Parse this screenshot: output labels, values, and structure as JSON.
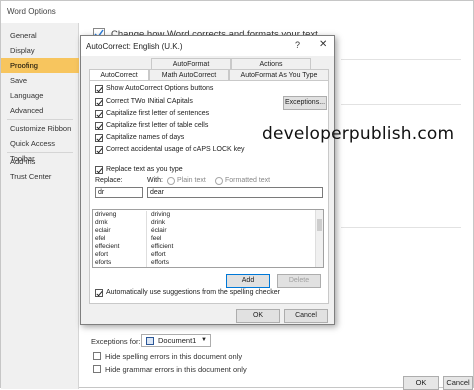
{
  "window": {
    "title": "Word Options"
  },
  "sidebar": {
    "items": [
      {
        "label": "General"
      },
      {
        "label": "Display"
      },
      {
        "label": "Proofing"
      },
      {
        "label": "Save"
      },
      {
        "label": "Language"
      },
      {
        "label": "Advanced"
      },
      {
        "label": "Customize Ribbon"
      },
      {
        "label": "Quick Access Toolbar"
      },
      {
        "label": "Add-ins"
      },
      {
        "label": "Trust Center"
      }
    ],
    "active": "Proofing"
  },
  "background": {
    "heading": "Change how Word corrects and formats your text.",
    "exceptions_label": "Exceptions for:",
    "exceptions_doc": "Document1",
    "hide_spelling": "Hide spelling errors in this document only",
    "hide_grammar": "Hide grammar errors in this document only"
  },
  "dialog": {
    "title": "AutoCorrect: English (U.K.)",
    "help_glyph": "?",
    "close_glyph": "✕",
    "tabs_top": [
      "AutoFormat",
      "Actions"
    ],
    "tabs_bottom": [
      "AutoCorrect",
      "Math AutoCorrect",
      "AutoFormat As You Type"
    ],
    "active_tab": "AutoCorrect",
    "options": [
      {
        "label": "Show AutoCorrect Options buttons",
        "checked": true
      },
      {
        "label": "Correct TWo INitial CApitals",
        "checked": true
      },
      {
        "label": "Capitalize first letter of sentences",
        "checked": true
      },
      {
        "label": "Capitalize first letter of table cells",
        "checked": true
      },
      {
        "label": "Capitalize names of days",
        "checked": true
      },
      {
        "label": "Correct accidental usage of cAPS LOCK key",
        "checked": true
      }
    ],
    "exceptions_button": "Exceptions...",
    "replace_as_you_type": {
      "label": "Replace text as you type",
      "checked": true
    },
    "replace_label": "Replace:",
    "with_label": "With:",
    "plain_text": "Plain text",
    "formatted_text": "Formatted text",
    "replace_value": "dr",
    "with_value": "dear",
    "entries": [
      [
        "driveng",
        "driving"
      ],
      [
        "drnk",
        "drink"
      ],
      [
        "eclair",
        "éclair"
      ],
      [
        "efel",
        "feel"
      ],
      [
        "effecient",
        "efficient"
      ],
      [
        "efort",
        "effort"
      ],
      [
        "eforts",
        "efforts"
      ]
    ],
    "add_button": "Add",
    "delete_button": "Delete",
    "auto_suggest": {
      "label": "Automatically use suggestions from the spelling checker",
      "checked": true
    },
    "ok_button": "OK",
    "cancel_button": "Cancel"
  },
  "watermark": "developerpublish.com",
  "bottom": {
    "ok_button": "OK",
    "cancel_button": "Cancel"
  }
}
